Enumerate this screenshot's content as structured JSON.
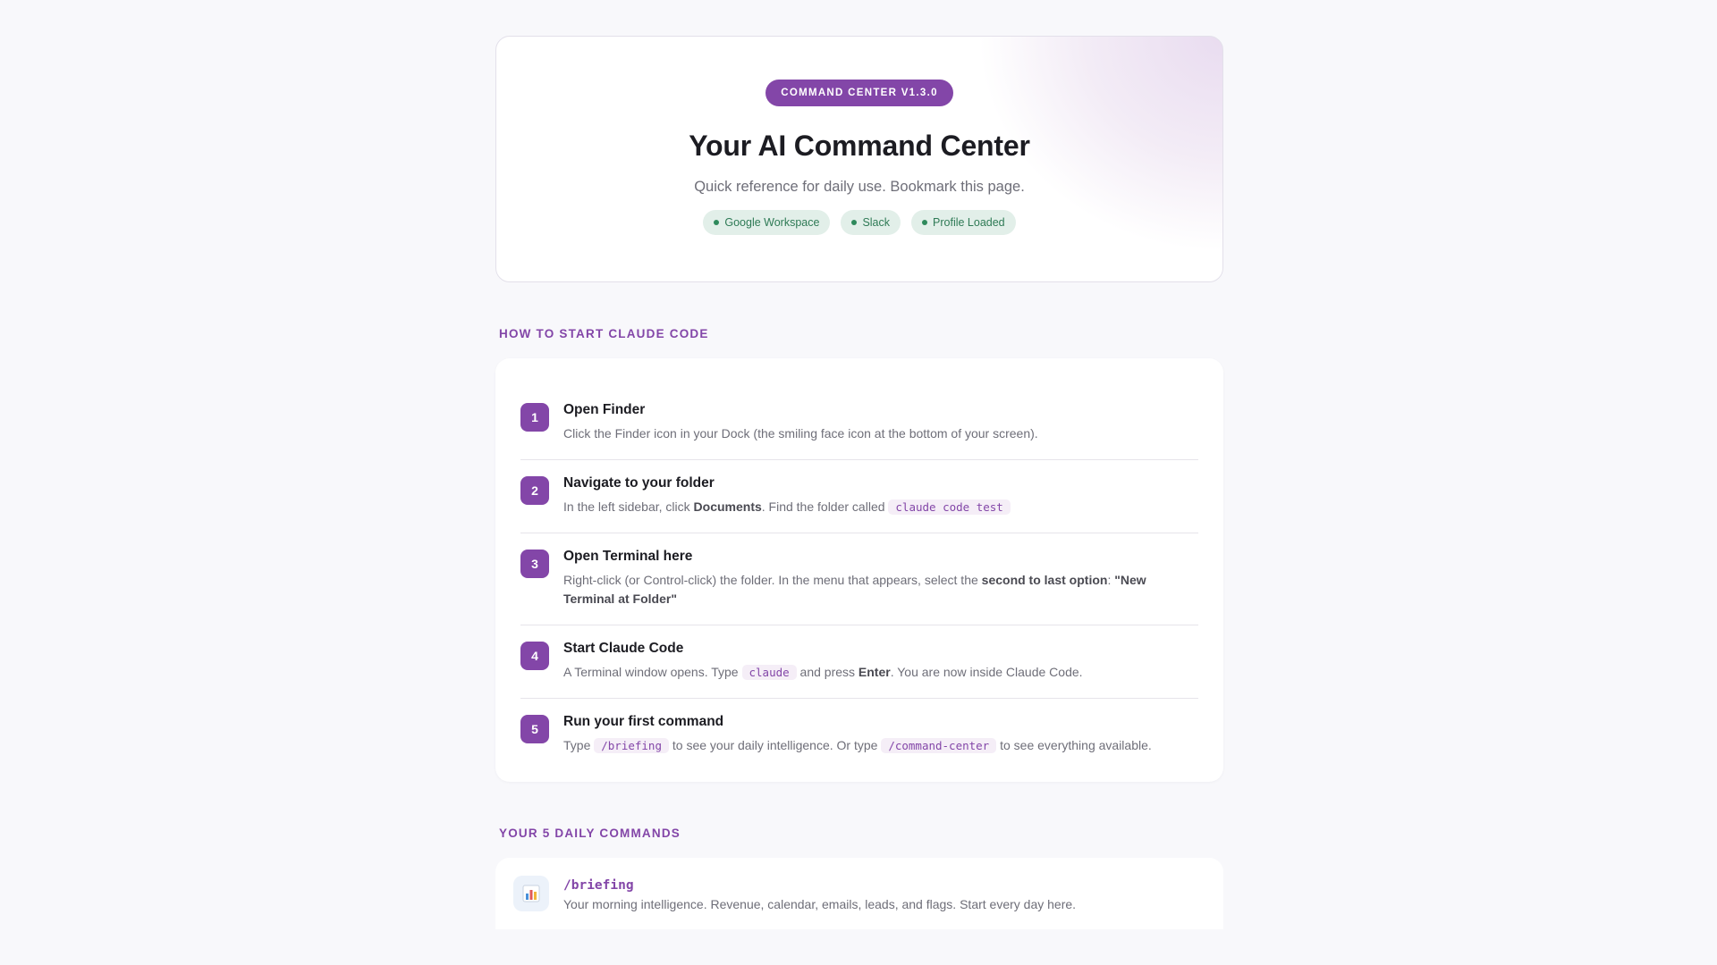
{
  "hero": {
    "version_pill": "COMMAND CENTER V1.3.0",
    "title": "Your AI Command Center",
    "subtitle": "Quick reference for daily use. Bookmark this page.",
    "badges": [
      "Google Workspace",
      "Slack",
      "Profile Loaded"
    ]
  },
  "steps_section": {
    "heading": "HOW TO START CLAUDE CODE",
    "steps": [
      {
        "number": "1",
        "title": "Open Finder",
        "desc": "Click the Finder icon in your Dock (the smiling face icon at the bottom of your screen)."
      },
      {
        "number": "2",
        "title": "Navigate to your folder",
        "desc_a": "In the left sidebar, click ",
        "desc_bold": "Documents",
        "desc_b": ". Find the folder called ",
        "desc_code": "claude code test"
      },
      {
        "number": "3",
        "title": "Open Terminal here",
        "desc_a": "Right-click (or Control-click) the folder. In the menu that appears, select the ",
        "desc_bold1": "second to last option",
        "desc_b": ": ",
        "desc_bold2": "\"New Terminal at Folder\""
      },
      {
        "number": "4",
        "title": "Start Claude Code",
        "desc_a": "A Terminal window opens. Type ",
        "desc_code": "claude",
        "desc_b": " and press ",
        "desc_bold": "Enter",
        "desc_c": ". You are now inside Claude Code."
      },
      {
        "number": "5",
        "title": "Run your first command",
        "desc_a": "Type ",
        "desc_code1": "/briefing",
        "desc_b": " to see your daily intelligence. Or type ",
        "desc_code2": "/command-center",
        "desc_c": " to see everything available."
      }
    ]
  },
  "commands_section": {
    "heading": "YOUR 5 DAILY COMMANDS",
    "commands": [
      {
        "icon": "bar-chart-icon",
        "name": "/briefing",
        "desc": "Your morning intelligence. Revenue, calendar, emails, leads, and flags. Start every day here."
      }
    ]
  },
  "colors": {
    "accent": "#8346a8",
    "badge_bg": "#e2efe9",
    "badge_text": "#2e7a55",
    "page_bg": "#f8f8fb"
  }
}
